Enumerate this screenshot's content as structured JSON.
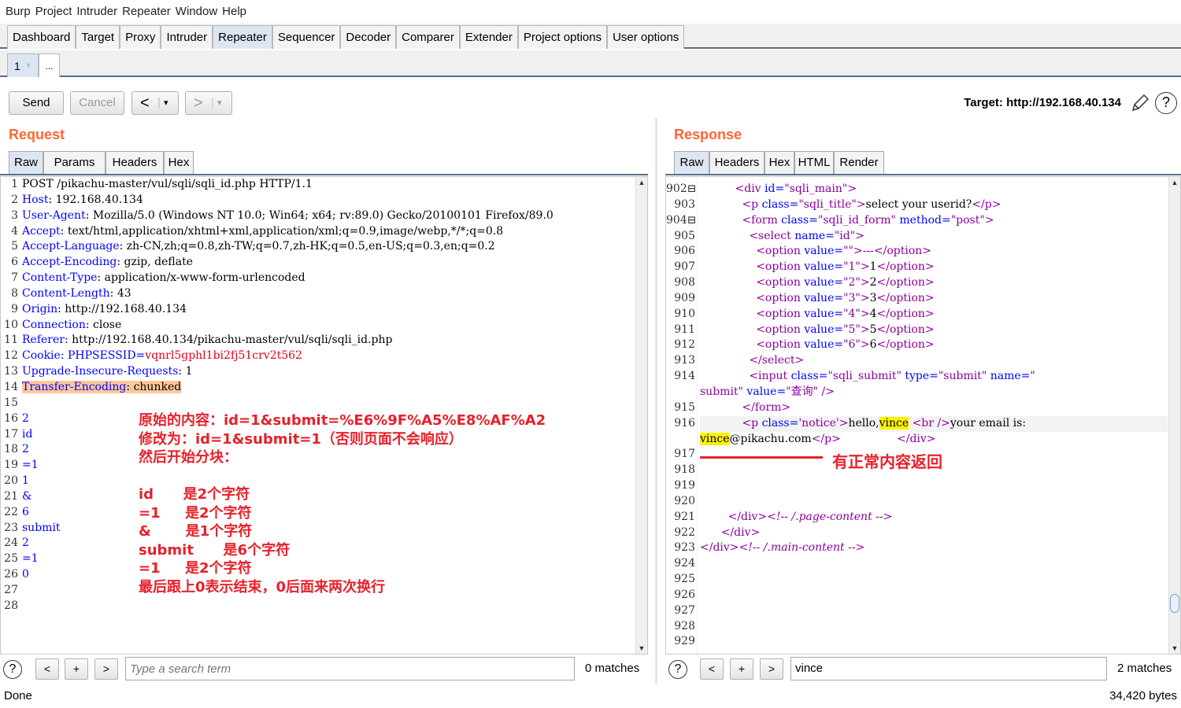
{
  "menubar": {
    "items": [
      "Burp",
      "Project",
      "Intruder",
      "Repeater",
      "Window",
      "Help"
    ]
  },
  "main_tabs": [
    "Dashboard",
    "Target",
    "Proxy",
    "Intruder",
    "Repeater",
    "Sequencer",
    "Decoder",
    "Comparer",
    "Extender",
    "Project options",
    "User options"
  ],
  "active_main_tab": "Repeater",
  "sub_tabs": {
    "first": "1",
    "first_close": "×",
    "more": "..."
  },
  "toolbar": {
    "send": "Send",
    "cancel": "Cancel",
    "back": "<",
    "forward": ">",
    "dropdown": "▾",
    "target_label": "Target: http://192.168.40.134",
    "edit_icon": "pencil-icon",
    "help_icon": "help-icon"
  },
  "request": {
    "title": "Request",
    "tabs": [
      "Raw",
      "Params",
      "Headers",
      "Hex"
    ],
    "line_numbers": [
      "1",
      "2",
      "3",
      "4",
      "5",
      "6",
      "7",
      "8",
      "9",
      "10",
      "11",
      "12",
      "13",
      "14",
      "15",
      "16",
      "17",
      "18",
      "19",
      "20",
      "21",
      "22",
      "23",
      "24",
      "25",
      "26",
      "27",
      "28"
    ],
    "lines": [
      {
        "segs": [
          {
            "t": "POST /pikachu-master/vul/sqli/sqli_id.php HTTP/1.1",
            "c": "hv"
          }
        ]
      },
      {
        "segs": [
          {
            "t": "Host",
            "c": "hn"
          },
          {
            "t": ": 192.168.40.134",
            "c": "hv"
          }
        ]
      },
      {
        "segs": [
          {
            "t": "User-Agent",
            "c": "hn"
          },
          {
            "t": ": Mozilla/5.0 (Windows NT 10.0; Win64; x64; rv:89.0) Gecko/20100101 Firefox/89.0",
            "c": "hv"
          }
        ]
      },
      {
        "segs": [
          {
            "t": "Accept",
            "c": "hn"
          },
          {
            "t": ": text/html,application/xhtml+xml,application/xml;q=0.9,image/webp,*/*;q=0.8",
            "c": "hv"
          }
        ]
      },
      {
        "segs": [
          {
            "t": "Accept-Language",
            "c": "hn"
          },
          {
            "t": ": zh-CN,zh;q=0.8,zh-TW;q=0.7,zh-HK;q=0.5,en-US;q=0.3,en;q=0.2",
            "c": "hv"
          }
        ]
      },
      {
        "segs": [
          {
            "t": "Accept-Encoding",
            "c": "hn"
          },
          {
            "t": ": gzip, deflate",
            "c": "hv"
          }
        ]
      },
      {
        "segs": [
          {
            "t": "Content-Type",
            "c": "hn"
          },
          {
            "t": ": application/x-www-form-urlencoded",
            "c": "hv"
          }
        ]
      },
      {
        "segs": [
          {
            "t": "Content-Length",
            "c": "hn"
          },
          {
            "t": ": 43",
            "c": "hv"
          }
        ]
      },
      {
        "segs": [
          {
            "t": "Origin",
            "c": "hn"
          },
          {
            "t": ": http://192.168.40.134",
            "c": "hv"
          }
        ]
      },
      {
        "segs": [
          {
            "t": "Connection",
            "c": "hn"
          },
          {
            "t": ": close",
            "c": "hv"
          }
        ]
      },
      {
        "segs": [
          {
            "t": "Referer",
            "c": "hn"
          },
          {
            "t": ": http://192.168.40.134/pikachu-master/vul/sqli/sqli_id.php",
            "c": "hv"
          }
        ]
      },
      {
        "segs": [
          {
            "t": "Cookie",
            "c": "hn"
          },
          {
            "t": ": PHPSESSID=",
            "c": "hn"
          },
          {
            "t": "vqnrl5gphl1bi2fj51crv2t562",
            "c": "red"
          }
        ]
      },
      {
        "segs": [
          {
            "t": "Upgrade-Insecure-Requests",
            "c": "hn"
          },
          {
            "t": ": 1",
            "c": "hv"
          }
        ]
      },
      {
        "segs": [
          {
            "t": "Transfer-Encoding",
            "c": "hn hl-orange"
          },
          {
            "t": ": chunked",
            "c": "hv hl-orange"
          }
        ]
      },
      {
        "segs": [
          {
            "t": "",
            "c": "hv"
          }
        ]
      },
      {
        "segs": [
          {
            "t": "2",
            "c": "hn"
          }
        ]
      },
      {
        "segs": [
          {
            "t": "id",
            "c": "hn"
          }
        ]
      },
      {
        "segs": [
          {
            "t": "2",
            "c": "hn"
          }
        ]
      },
      {
        "segs": [
          {
            "t": "=1",
            "c": "hn"
          }
        ]
      },
      {
        "segs": [
          {
            "t": "1",
            "c": "hn"
          }
        ]
      },
      {
        "segs": [
          {
            "t": "&",
            "c": "hn"
          }
        ]
      },
      {
        "segs": [
          {
            "t": "6",
            "c": "hn"
          }
        ]
      },
      {
        "segs": [
          {
            "t": "submit",
            "c": "hn"
          }
        ]
      },
      {
        "segs": [
          {
            "t": "2",
            "c": "hn"
          }
        ]
      },
      {
        "segs": [
          {
            "t": "=1",
            "c": "hn"
          }
        ]
      },
      {
        "segs": [
          {
            "t": "0",
            "c": "hn"
          }
        ]
      },
      {
        "segs": [
          {
            "t": "",
            "c": "hv"
          }
        ]
      },
      {
        "segs": [
          {
            "t": "",
            "c": "hv"
          }
        ]
      }
    ],
    "annotation": [
      "原始的内容：id=1&submit=%E6%9F%A5%E8%AF%A2",
      "修改为：id=1&submit=1（否则页面不会响应）",
      "然后开始分块：",
      "",
      "id      是2个字符",
      "=1     是2个字符",
      "&       是1个字符",
      "submit      是6个字符",
      "=1     是2个字符",
      "最后跟上0表示结束，0后面来两次换行"
    ],
    "search": {
      "help": "?",
      "prev": "<",
      "add": "+",
      "next": ">",
      "placeholder": "Type a search term",
      "value": "",
      "matches": "0 matches"
    }
  },
  "response": {
    "title": "Response",
    "tabs": [
      "Raw",
      "Headers",
      "Hex",
      "HTML",
      "Render"
    ],
    "line_numbers": [
      "902⊟",
      "903",
      "904⊟",
      "905",
      "906",
      "907",
      "908",
      "909",
      "910",
      "911",
      "912",
      "913",
      "914",
      "",
      "915",
      "916",
      "",
      "917",
      "918",
      "919",
      "920",
      "921",
      "922",
      "923",
      "924",
      "925",
      "926",
      "927",
      "928",
      "929"
    ],
    "lines": [
      {
        "segs": [
          {
            "t": "          ",
            "c": "txt"
          },
          {
            "t": "<div ",
            "c": "tag"
          },
          {
            "t": "id=",
            "c": "attr"
          },
          {
            "t": "\"sqli_main\"",
            "c": "val"
          },
          {
            "t": ">",
            "c": "tag"
          }
        ]
      },
      {
        "segs": [
          {
            "t": "            ",
            "c": "txt"
          },
          {
            "t": "<p ",
            "c": "tag"
          },
          {
            "t": "class=",
            "c": "attr"
          },
          {
            "t": "\"sqli_title\"",
            "c": "val"
          },
          {
            "t": ">",
            "c": "tag"
          },
          {
            "t": "select your userid?",
            "c": "txt"
          },
          {
            "t": "</p>",
            "c": "tag"
          }
        ]
      },
      {
        "segs": [
          {
            "t": "            ",
            "c": "txt"
          },
          {
            "t": "<form ",
            "c": "tag"
          },
          {
            "t": "class=",
            "c": "attr"
          },
          {
            "t": "\"sqli_id_form\"",
            "c": "val"
          },
          {
            "t": " method=",
            "c": "attr"
          },
          {
            "t": "\"post\"",
            "c": "val"
          },
          {
            "t": ">",
            "c": "tag"
          }
        ]
      },
      {
        "segs": [
          {
            "t": "              ",
            "c": "txt"
          },
          {
            "t": "<select ",
            "c": "tag"
          },
          {
            "t": "name=",
            "c": "attr"
          },
          {
            "t": "\"id\"",
            "c": "val"
          },
          {
            "t": ">",
            "c": "tag"
          }
        ]
      },
      {
        "segs": [
          {
            "t": "                ",
            "c": "txt"
          },
          {
            "t": "<option ",
            "c": "tag"
          },
          {
            "t": "value=",
            "c": "attr"
          },
          {
            "t": "\"\"",
            "c": "val"
          },
          {
            "t": ">---</option>",
            "c": "tag"
          }
        ]
      },
      {
        "segs": [
          {
            "t": "                ",
            "c": "txt"
          },
          {
            "t": "<option ",
            "c": "tag"
          },
          {
            "t": "value=",
            "c": "attr"
          },
          {
            "t": "\"1\"",
            "c": "val"
          },
          {
            "t": ">",
            "c": "tag"
          },
          {
            "t": "1",
            "c": "txt"
          },
          {
            "t": "</option>",
            "c": "tag"
          }
        ]
      },
      {
        "segs": [
          {
            "t": "                ",
            "c": "txt"
          },
          {
            "t": "<option ",
            "c": "tag"
          },
          {
            "t": "value=",
            "c": "attr"
          },
          {
            "t": "\"2\"",
            "c": "val"
          },
          {
            "t": ">",
            "c": "tag"
          },
          {
            "t": "2",
            "c": "txt"
          },
          {
            "t": "</option>",
            "c": "tag"
          }
        ]
      },
      {
        "segs": [
          {
            "t": "                ",
            "c": "txt"
          },
          {
            "t": "<option ",
            "c": "tag"
          },
          {
            "t": "value=",
            "c": "attr"
          },
          {
            "t": "\"3\"",
            "c": "val"
          },
          {
            "t": ">",
            "c": "tag"
          },
          {
            "t": "3",
            "c": "txt"
          },
          {
            "t": "</option>",
            "c": "tag"
          }
        ]
      },
      {
        "segs": [
          {
            "t": "                ",
            "c": "txt"
          },
          {
            "t": "<option ",
            "c": "tag"
          },
          {
            "t": "value=",
            "c": "attr"
          },
          {
            "t": "\"4\"",
            "c": "val"
          },
          {
            "t": ">",
            "c": "tag"
          },
          {
            "t": "4",
            "c": "txt"
          },
          {
            "t": "</option>",
            "c": "tag"
          }
        ]
      },
      {
        "segs": [
          {
            "t": "                ",
            "c": "txt"
          },
          {
            "t": "<option ",
            "c": "tag"
          },
          {
            "t": "value=",
            "c": "attr"
          },
          {
            "t": "\"5\"",
            "c": "val"
          },
          {
            "t": ">",
            "c": "tag"
          },
          {
            "t": "5",
            "c": "txt"
          },
          {
            "t": "</option>",
            "c": "tag"
          }
        ]
      },
      {
        "segs": [
          {
            "t": "                ",
            "c": "txt"
          },
          {
            "t": "<option ",
            "c": "tag"
          },
          {
            "t": "value=",
            "c": "attr"
          },
          {
            "t": "\"6\"",
            "c": "val"
          },
          {
            "t": ">",
            "c": "tag"
          },
          {
            "t": "6",
            "c": "txt"
          },
          {
            "t": "</option>",
            "c": "tag"
          }
        ]
      },
      {
        "segs": [
          {
            "t": "              ",
            "c": "txt"
          },
          {
            "t": "</select>",
            "c": "tag"
          }
        ]
      },
      {
        "segs": [
          {
            "t": "              ",
            "c": "txt"
          },
          {
            "t": "<input ",
            "c": "tag"
          },
          {
            "t": "class=",
            "c": "attr"
          },
          {
            "t": "\"sqli_submit\"",
            "c": "val"
          },
          {
            "t": " type=",
            "c": "attr"
          },
          {
            "t": "\"submit\"",
            "c": "val"
          },
          {
            "t": " name=",
            "c": "attr"
          },
          {
            "t": "\"",
            "c": "val"
          }
        ]
      },
      {
        "segs": [
          {
            "t": "submit\"",
            "c": "val"
          },
          {
            "t": " value=",
            "c": "attr"
          },
          {
            "t": "\"查询\"",
            "c": "val"
          },
          {
            "t": " />",
            "c": "tag"
          }
        ]
      },
      {
        "segs": [
          {
            "t": "            ",
            "c": "txt"
          },
          {
            "t": "</form>",
            "c": "tag"
          }
        ]
      },
      {
        "segs": [
          {
            "t": "            ",
            "c": "txt"
          },
          {
            "t": "<p ",
            "c": "tag"
          },
          {
            "t": "class=",
            "c": "attr"
          },
          {
            "t": "'notice'",
            "c": "val"
          },
          {
            "t": ">",
            "c": "tag"
          },
          {
            "t": "hello,",
            "c": "txt"
          },
          {
            "t": "vince",
            "c": "txt hl-yellow"
          },
          {
            "t": " ",
            "c": "txt"
          },
          {
            "t": "<br />",
            "c": "tag"
          },
          {
            "t": "your email is:",
            "c": "txt"
          }
        ]
      },
      {
        "segs": [
          {
            "t": "vince",
            "c": "txt hl-yellow"
          },
          {
            "t": "@pikachu.com",
            "c": "txt"
          },
          {
            "t": "</p>",
            "c": "tag"
          },
          {
            "t": "                ",
            "c": "txt"
          },
          {
            "t": "</div>",
            "c": "tag"
          }
        ]
      },
      {
        "segs": [
          {
            "t": "",
            "c": "txt"
          }
        ]
      },
      {
        "segs": [
          {
            "t": "",
            "c": "txt"
          }
        ]
      },
      {
        "segs": [
          {
            "t": "",
            "c": "txt"
          }
        ]
      },
      {
        "segs": [
          {
            "t": "",
            "c": "txt"
          }
        ]
      },
      {
        "segs": [
          {
            "t": "        ",
            "c": "txt"
          },
          {
            "t": "</div>",
            "c": "tag"
          },
          {
            "t": "<!-- /.page-content -->",
            "c": "cmt"
          }
        ]
      },
      {
        "segs": [
          {
            "t": "      ",
            "c": "txt"
          },
          {
            "t": "</div>",
            "c": "tag"
          }
        ]
      },
      {
        "segs": [
          {
            "t": "",
            "c": "txt"
          },
          {
            "t": "</div>",
            "c": "tag"
          },
          {
            "t": "<!-- /.main-content -->",
            "c": "cmt"
          }
        ]
      },
      {
        "segs": [
          {
            "t": "",
            "c": "txt"
          }
        ]
      },
      {
        "segs": [
          {
            "t": "",
            "c": "txt"
          }
        ]
      },
      {
        "segs": [
          {
            "t": "",
            "c": "txt"
          }
        ]
      },
      {
        "segs": [
          {
            "t": "",
            "c": "txt"
          }
        ]
      },
      {
        "segs": [
          {
            "t": "",
            "c": "txt"
          }
        ]
      },
      {
        "segs": [
          {
            "t": "",
            "c": "txt"
          }
        ]
      }
    ],
    "annotation": "有正常内容返回",
    "search": {
      "help": "?",
      "prev": "<",
      "add": "+",
      "next": ">",
      "value": "vince",
      "matches": "2 matches"
    }
  },
  "status": {
    "left": "Done",
    "right": "34,420 bytes"
  },
  "colors": {
    "accent_orange": "#ff6633",
    "tab_active": "#dce6f2",
    "annotation_red": "#e8202a",
    "highlight_yellow": "#fff200",
    "highlight_orange": "#ffc89a"
  }
}
